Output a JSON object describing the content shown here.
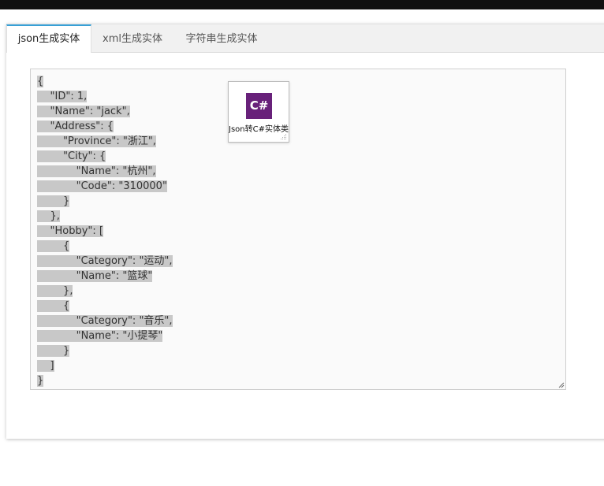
{
  "tabs": [
    {
      "label": "json生成实体",
      "active": true
    },
    {
      "label": "xml生成实体",
      "active": false
    },
    {
      "label": "字符串生成实体",
      "active": false
    }
  ],
  "editor": {
    "lines": [
      "{",
      "    \"ID\": 1,",
      "    \"Name\": \"jack\",",
      "    \"Address\": {",
      "        \"Province\": \"浙江\",",
      "        \"City\": {",
      "            \"Name\": \"杭州\",",
      "            \"Code\": \"310000\"",
      "        }",
      "    },",
      "    \"Hobby\": [",
      "        {",
      "            \"Category\": \"运动\",",
      "            \"Name\": \"篮球\"",
      "        },",
      "        {",
      "            \"Category\": \"音乐\",",
      "            \"Name\": \"小提琴\"",
      "        }",
      "    ]",
      "}"
    ]
  },
  "widget": {
    "logo_text": "C#",
    "label": "Json转C#实体类",
    "logo_color": "#68217a"
  },
  "colors": {
    "accent": "#38a0d6",
    "selection": "#c8c8c8"
  }
}
